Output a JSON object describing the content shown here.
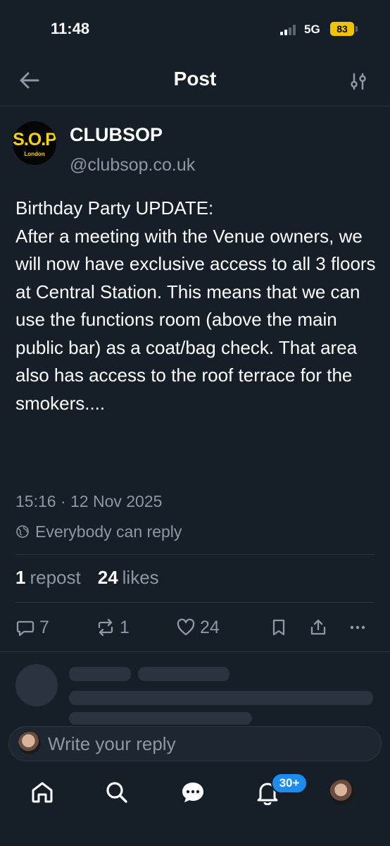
{
  "status_bar": {
    "time": "11:48",
    "network": "5G",
    "battery": "83",
    "battery_color": "#f0c400"
  },
  "header": {
    "title": "Post",
    "back_icon": "arrow-left-icon",
    "filter_icon": "sliders-icon"
  },
  "post": {
    "author": {
      "name": "CLUBSOP",
      "handle": "@clubsop.co.uk",
      "avatar_text": "S.O.P",
      "avatar_subtext": "London"
    },
    "text": "Birthday Party UPDATE:\nAfter a meeting with the Venue owners, we will now have exclusive access to all 3 floors at Central Station. This means that we can use the functions room (above the main public bar) as a coat/bag check. That area also has access to the roof terrace for the smokers....",
    "timestamp": "15:16 · 12 Nov 2025",
    "reply_setting": "Everybody can reply",
    "stats": {
      "reposts": "1",
      "reposts_label": "repost",
      "likes": "24",
      "likes_label": "likes"
    },
    "actions": {
      "replies": "7",
      "reposts": "1",
      "likes": "24"
    }
  },
  "reply_box": {
    "placeholder": "Write your reply"
  },
  "bottom_nav": {
    "items": [
      "home-icon",
      "search-icon",
      "chat-icon",
      "bell-icon",
      "profile-avatar"
    ],
    "notifications_badge": "30+",
    "badge_color": "#1d8cf0"
  },
  "colors": {
    "background": "#161e27",
    "muted_text": "#8b98a5",
    "divider": "#2a333e"
  }
}
